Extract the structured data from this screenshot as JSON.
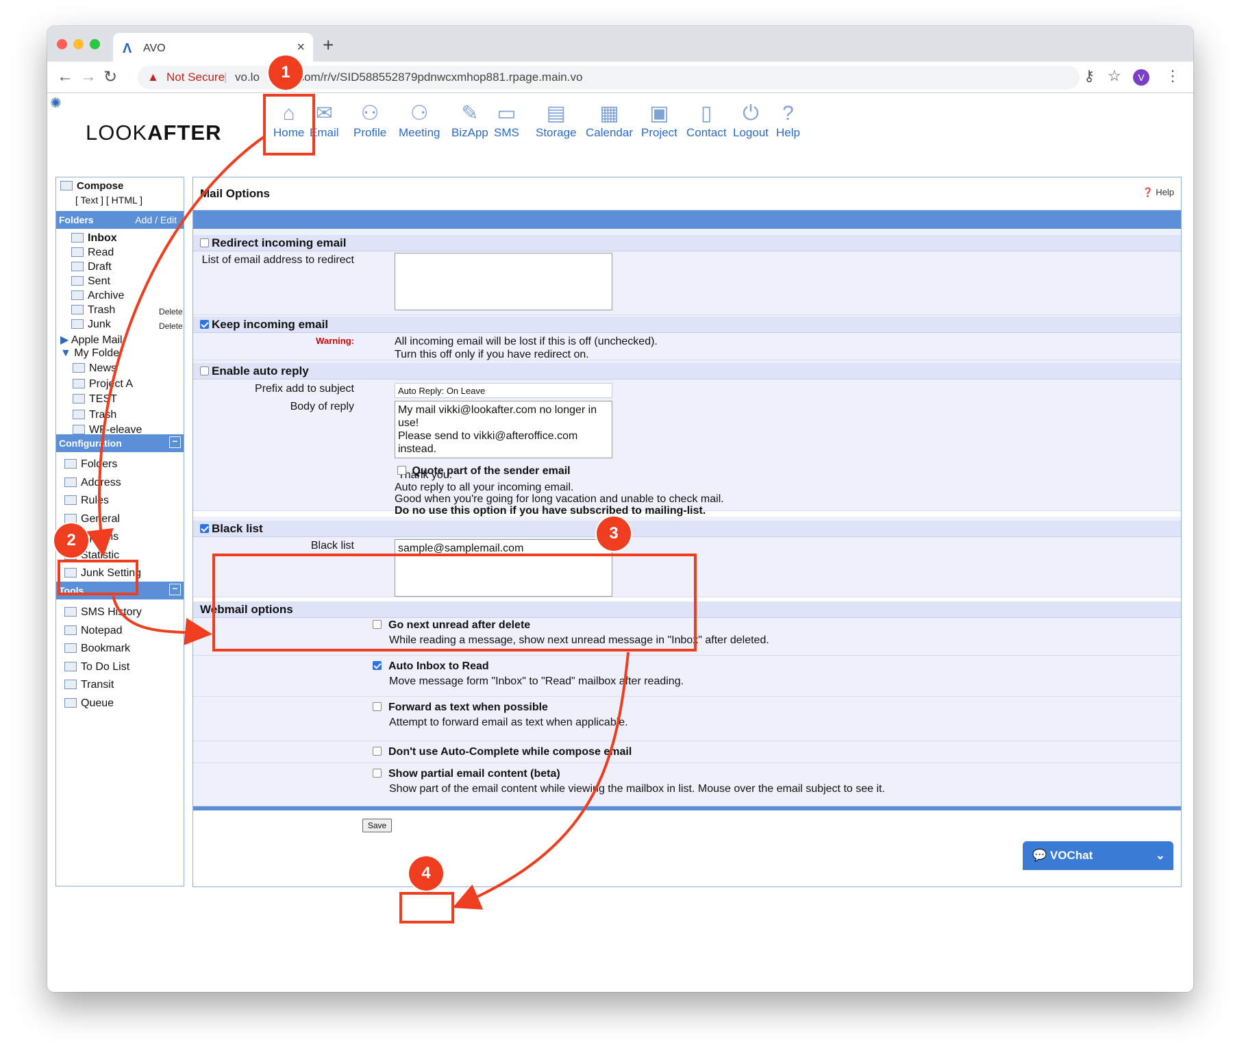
{
  "browser": {
    "tab_title": "AVO",
    "new_tab": "+",
    "security_label": "Not Secure",
    "url": "vo.lo          r.com/r/v/SID588552879pdnwcxmhop881.rpage.main.vo",
    "avatar_letter": "V"
  },
  "app": {
    "brand_light": "LOOK",
    "brand_bold": "AFTER",
    "nav": [
      {
        "label": "Home",
        "icon": "home-icon"
      },
      {
        "label": "Email",
        "icon": "envelope-icon"
      },
      {
        "label": "Profile",
        "icon": "user-icon"
      },
      {
        "label": "Meeting",
        "icon": "meeting-icon"
      },
      {
        "label": "BizApp",
        "icon": "puzzle-icon"
      },
      {
        "label": "SMS",
        "icon": "chat-icon"
      },
      {
        "label": "Storage",
        "icon": "folder-icon"
      },
      {
        "label": "Calendar",
        "icon": "calendar-icon"
      },
      {
        "label": "Project",
        "icon": "briefcase-icon"
      },
      {
        "label": "Contact",
        "icon": "contact-book-icon"
      },
      {
        "label": "Logout",
        "icon": "power-icon"
      },
      {
        "label": "Help",
        "icon": "question-icon"
      }
    ]
  },
  "sidebar": {
    "compose": "Compose",
    "compose_modes": "[ Text ] [ HTML ]",
    "folders_title": "Folders",
    "folders_action": "Add / Edit",
    "folders": [
      {
        "label": "Inbox"
      },
      {
        "label": "Read"
      },
      {
        "label": "Draft"
      },
      {
        "label": "Sent"
      },
      {
        "label": "Archive"
      },
      {
        "label": "Trash",
        "action": "Delete"
      },
      {
        "label": "Junk",
        "action": "Delete"
      }
    ],
    "apple_mail": "Apple Mail",
    "my_folder": "My Folder",
    "my_folder_items": [
      "News",
      "Project A",
      "TEST",
      "Trash",
      "WF-eleave"
    ],
    "config_title": "Configuration",
    "config_items": [
      "Folders",
      "Address",
      "Rules",
      "General",
      "Options",
      "Statistic",
      "Junk Setting"
    ],
    "tools_title": "Tools",
    "tools_items": [
      "SMS History",
      "Notepad",
      "Bookmark",
      "To Do List",
      "Transit",
      "Queue"
    ]
  },
  "main": {
    "title": "Mail Options",
    "help": "Help",
    "redirect_title": "Redirect incoming email",
    "redirect_label": "List of email address to redirect",
    "keep_title": "Keep incoming email",
    "warning_label": "Warning:",
    "warning_line1": "All incoming email will be lost if this is off (unchecked).",
    "warning_line2": "Turn this off only if you have redirect on.",
    "autoreply_title": "Enable auto reply",
    "prefix_label": "Prefix add to subject",
    "prefix_value": "Auto Reply: On Leave",
    "body_label": "Body of reply",
    "body_value": "My mail vikki@lookafter.com no longer in use!\nPlease send to vikki@afteroffice.com instead.\n\nThank you.",
    "quote_label": "Quote part of the sender email",
    "autoreply_note1": "Auto reply to all your incoming email.",
    "autoreply_note2": "Good when you're going for long vacation and unable to check mail.",
    "autoreply_note3": "Do no use this option if you have subscribed to mailing-list.",
    "blacklist_title": "Black list",
    "blacklist_label": "Black list",
    "blacklist_value": "sample@samplemail.com",
    "webmail_title": "Webmail options",
    "options": [
      {
        "title": "Go next unread after delete",
        "desc": "While reading a message, show next unread message in \"Inbox\" after deleted.",
        "checked": false
      },
      {
        "title": "Auto Inbox to Read",
        "desc": "Move message form \"Inbox\" to \"Read\" mailbox after reading.",
        "checked": true
      },
      {
        "title": "Forward as text when possible",
        "desc": "Attempt to forward email as text when applicable.",
        "checked": false
      },
      {
        "title": "Don't use Auto-Complete while compose email",
        "desc": "",
        "checked": false
      },
      {
        "title": "Show partial email content (beta)",
        "desc": "Show part of the email content while viewing the mailbox in list. Mouse over the email subject to see it.",
        "checked": false
      }
    ],
    "save": "Save"
  },
  "chat": {
    "label": "VOChat"
  },
  "annotations": {
    "badges": [
      "1",
      "2",
      "3",
      "4"
    ],
    "accent_color": "#ee3e1f"
  }
}
